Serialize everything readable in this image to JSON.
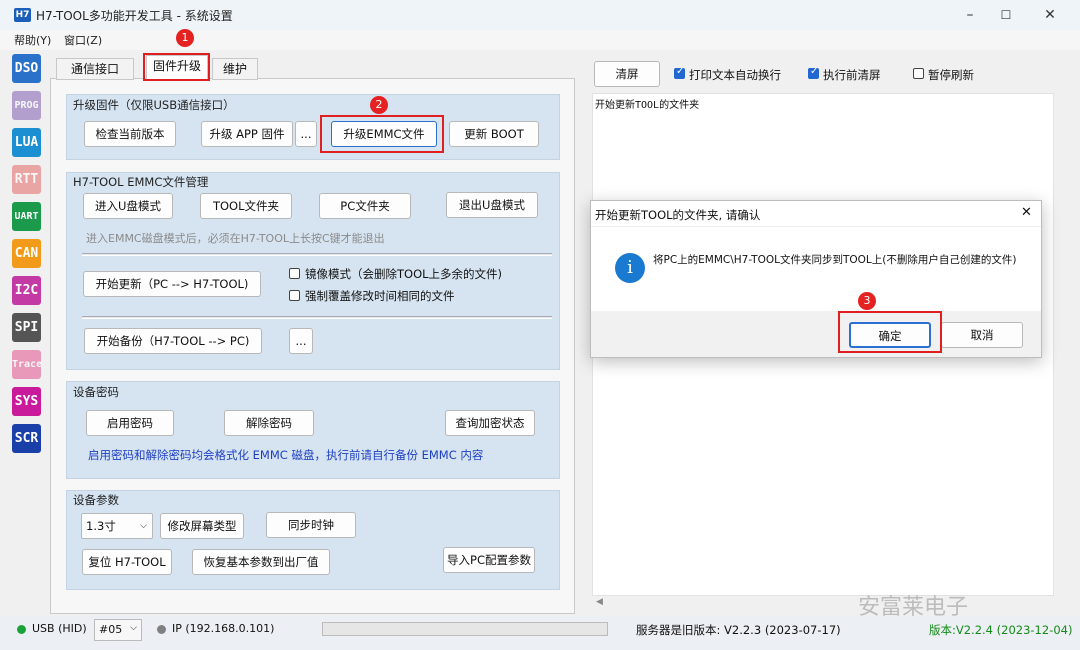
{
  "window": {
    "icon_text": "H7",
    "title": "H7-TOOL多功能开发工具 - 系统设置"
  },
  "menu": [
    "帮助(Y)",
    "窗口(Z)"
  ],
  "sidebar": [
    {
      "label": "DSO",
      "color": "#2a72c9",
      "dim": false
    },
    {
      "label": "PROG",
      "color": "#6a3ea6",
      "dim": true
    },
    {
      "label": "LUA",
      "color": "#1c8fd2",
      "dim": false
    },
    {
      "label": "RTT",
      "color": "#e24a4a",
      "dim": true
    },
    {
      "label": "UART",
      "color": "#1a9a4a",
      "dim": false
    },
    {
      "label": "CAN",
      "color": "#f29a1a",
      "dim": false
    },
    {
      "label": "I2C",
      "color": "#c33aa5",
      "dim": false
    },
    {
      "label": "SPI",
      "color": "#555555",
      "dim": false
    },
    {
      "label": "Trace",
      "color": "#e0307a",
      "dim": true
    },
    {
      "label": "SYS",
      "color": "#c81a9a",
      "dim": false
    },
    {
      "label": "SCR",
      "color": "#1a3fa8",
      "dim": false
    }
  ],
  "tabs": [
    "通信接口",
    "固件升级",
    "维护"
  ],
  "firmware": {
    "title": "升级固件（仅限USB通信接口）",
    "check": "检查当前版本",
    "app": "升级 APP 固件",
    "dots": "...",
    "emmc": "升级EMMC文件",
    "boot": "更新 BOOT"
  },
  "emmc": {
    "title": "H7-TOOL EMMC文件管理",
    "udisk": "进入U盘模式",
    "tool_folder": "TOOL文件夹",
    "pc_folder": "PC文件夹",
    "exit_udisk": "退出U盘模式",
    "hint": "进入EMMC磁盘模式后，必须在H7-TOOL上长按C键才能退出",
    "start_update": "开始更新（PC --> H7-TOOL)",
    "mirror": "镜像模式（会删除TOOL上多余的文件)",
    "overwrite": "强制覆盖修改时间相同的文件",
    "start_backup": "开始备份（H7-TOOL --> PC)",
    "dots": "..."
  },
  "password": {
    "title": "设备密码",
    "enable": "启用密码",
    "disable": "解除密码",
    "query": "查询加密状态",
    "note": "启用密码和解除密码均会格式化 EMMC 磁盘，执行前请自行备份 EMMC 内容"
  },
  "params": {
    "title": "设备参数",
    "size": "1.3寸",
    "change_screen": "修改屏幕类型",
    "sync_clock": "同步时钟",
    "reset": "复位 H7-TOOL",
    "restore": "恢复基本参数到出厂值",
    "import": "导入PC配置参数"
  },
  "right": {
    "clear": "清屏",
    "autowrap": "打印文本自动换行",
    "clear_before": "执行前清屏",
    "pause": "暂停刷新",
    "log": "开始更新TOOL的文件夹"
  },
  "dialog": {
    "title": "开始更新TOOL的文件夹, 请确认",
    "message": "将PC上的EMMC\\H7-TOOL文件夹同步到TOOL上(不删除用户自己创建的文件)",
    "ok": "确定",
    "cancel": "取消"
  },
  "badges": [
    "1",
    "2",
    "3"
  ],
  "status": {
    "usb": "USB (HID)",
    "port": "#05",
    "ip": "IP (192.168.0.101)",
    "server": "服务器是旧版本: V2.2.3 (2023-07-17)",
    "version": "版本:V2.2.4 (2023-12-04)"
  },
  "watermark": "安富莱电子"
}
